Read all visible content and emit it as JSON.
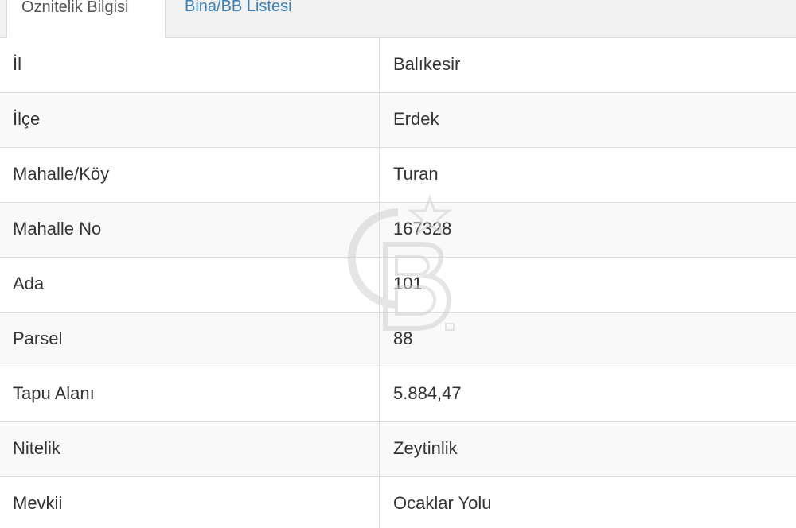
{
  "tabs": [
    {
      "label": "Öznitelik Bilgisi",
      "active": true
    },
    {
      "label": "Bina/BB Listesi",
      "active": false
    }
  ],
  "rows": [
    {
      "key": "İl",
      "value": "Balıkesir"
    },
    {
      "key": "İlçe",
      "value": "Erdek"
    },
    {
      "key": "Mahalle/Köy",
      "value": "Turan"
    },
    {
      "key": "Mahalle No",
      "value": "167328"
    },
    {
      "key": "Ada",
      "value": "101"
    },
    {
      "key": "Parsel",
      "value": "88"
    },
    {
      "key": "Tapu Alanı",
      "value": "5.884,47"
    },
    {
      "key": "Nitelik",
      "value": "Zeytinlik"
    },
    {
      "key": "Mevkii",
      "value": "Ocaklar Yolu"
    }
  ],
  "colors": {
    "tab_link": "#3a7fb8",
    "border": "#dddddd",
    "stripe": "#f9f9f9"
  }
}
